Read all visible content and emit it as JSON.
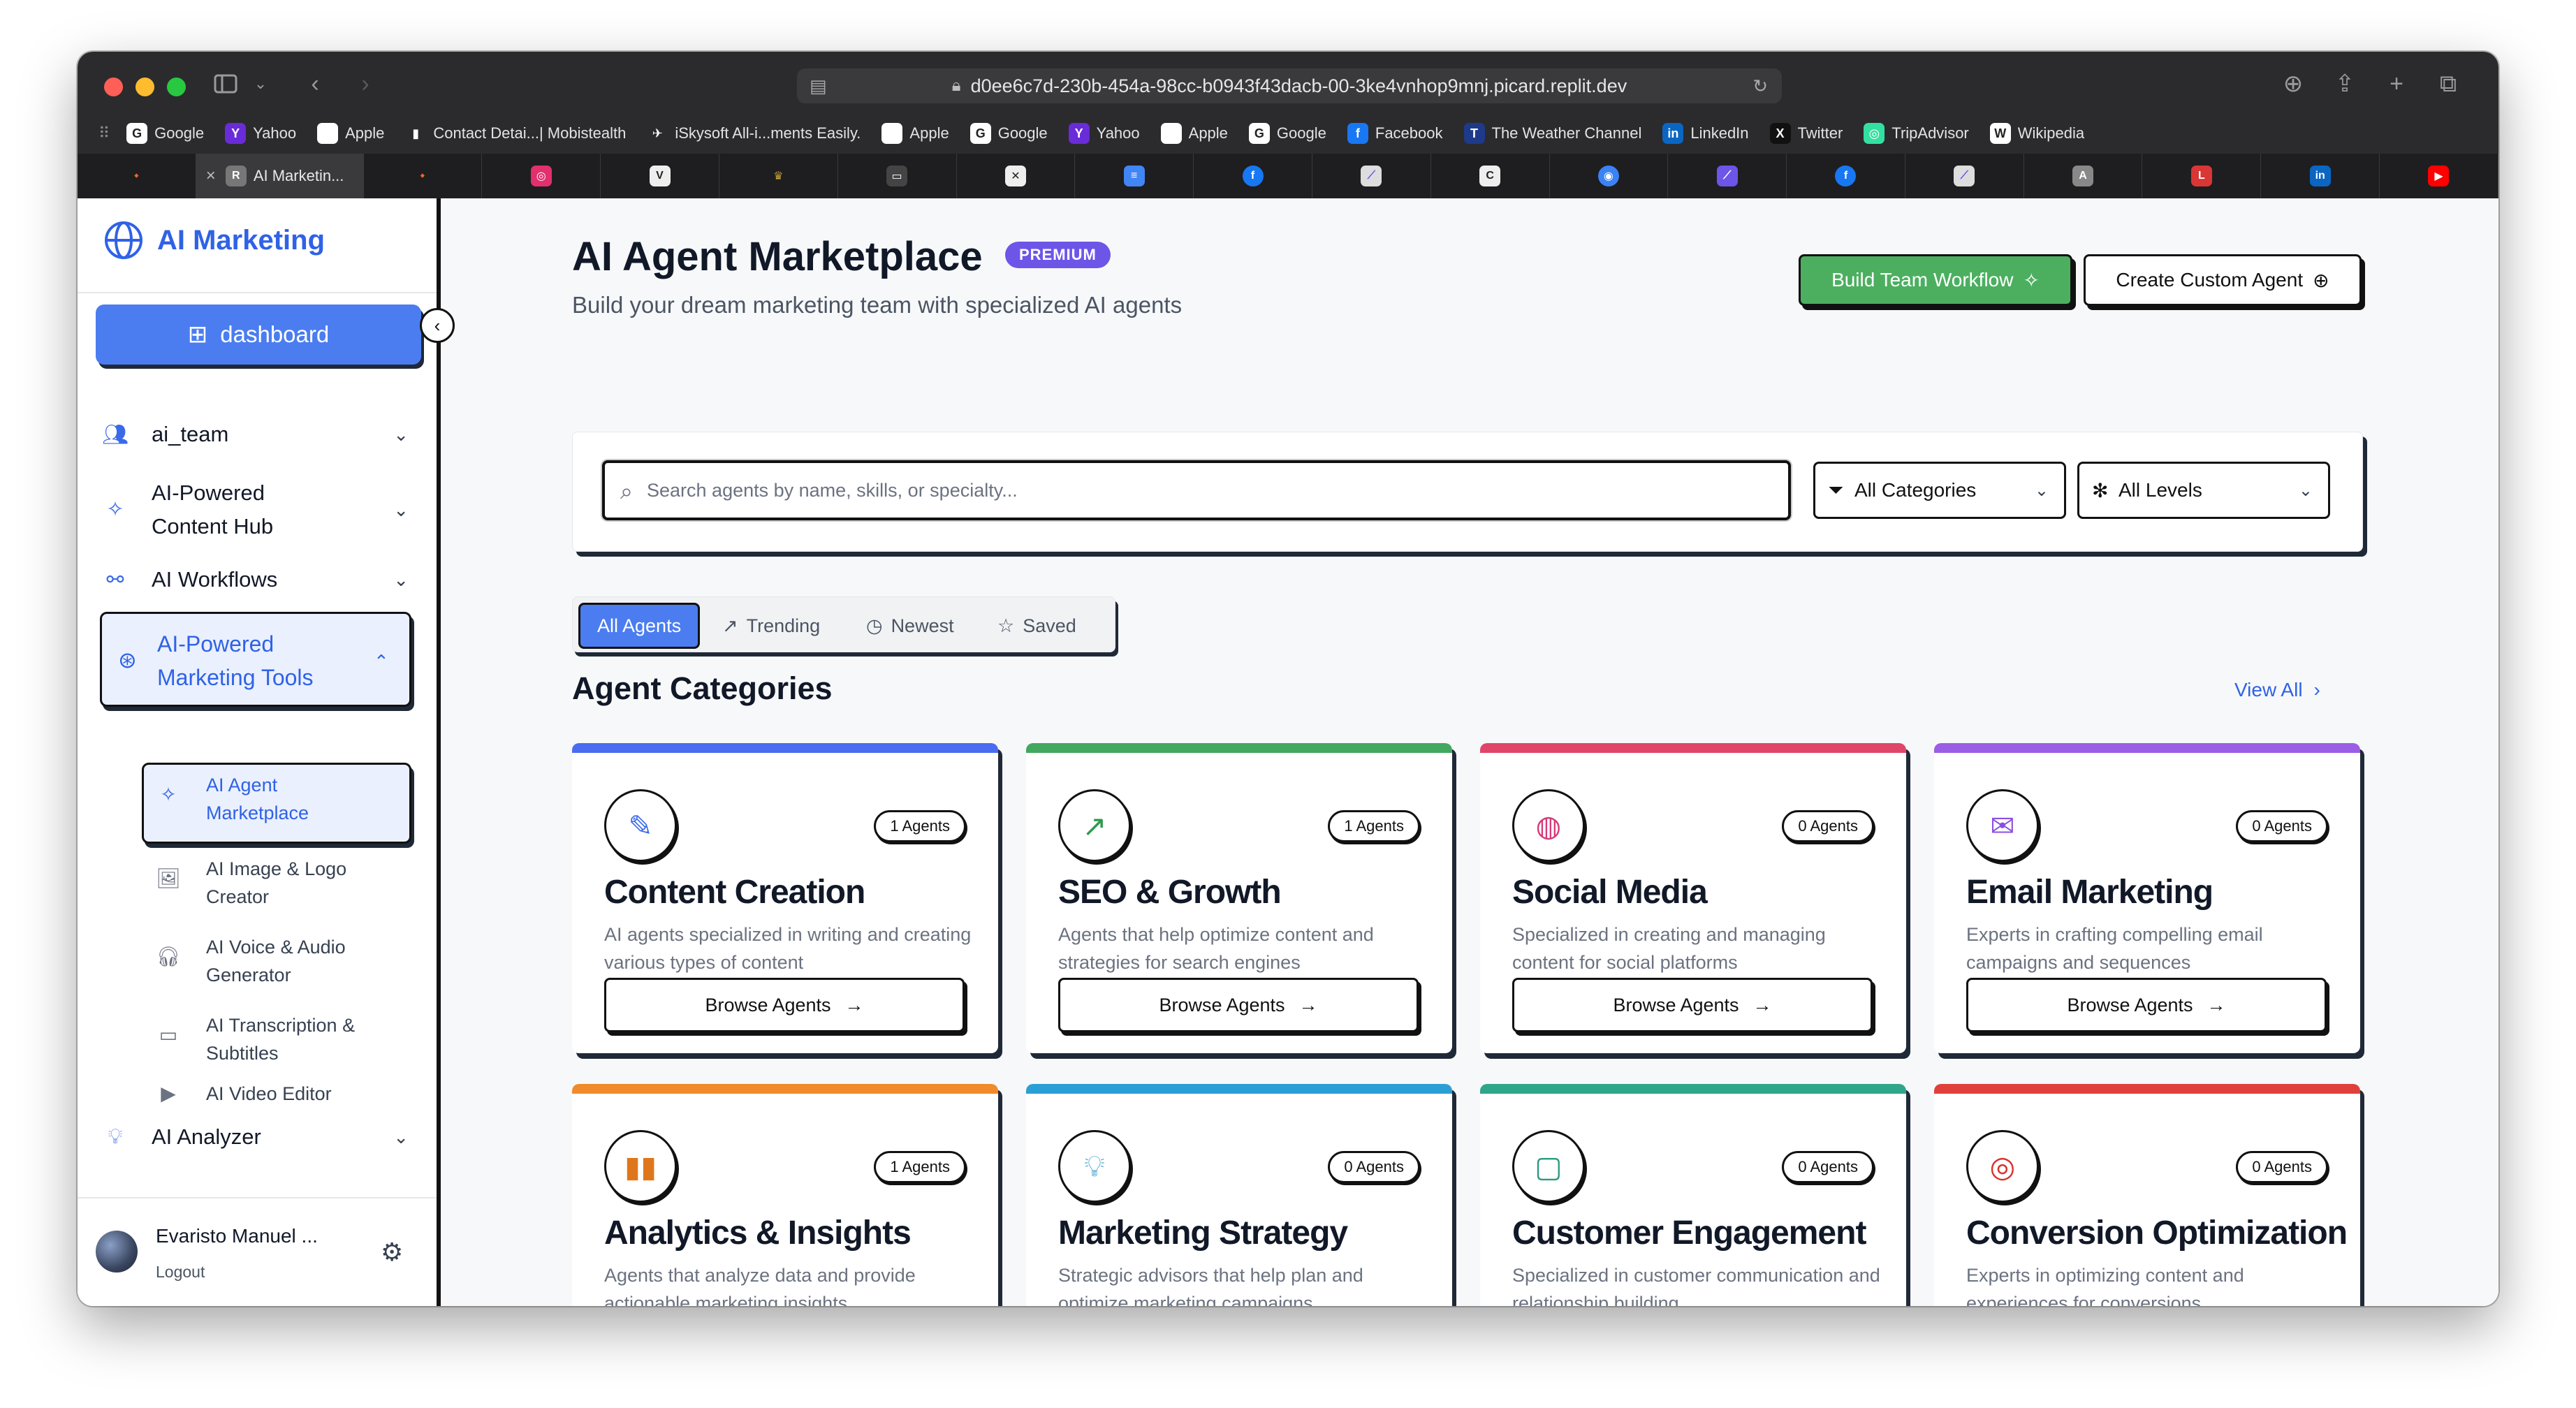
{
  "browser": {
    "url": "d0ee6c7d-230b-454a-98cc-b0943f43dacb-00-3ke4vnhop9mnj.picard.replit.dev",
    "bookmarks": [
      {
        "label": "Google",
        "color": "#ffffff",
        "glyph": "G"
      },
      {
        "label": "Yahoo",
        "color": "#6a2bd8",
        "glyph": "Y"
      },
      {
        "label": "Apple",
        "color": "#ffffff",
        "glyph": ""
      },
      {
        "label": "Contact Detai...| Mobistealth",
        "color": "#2b2b2d",
        "glyph": "▮"
      },
      {
        "label": "iSkysoft All-i...ments Easily.",
        "color": "#2b2b2d",
        "glyph": "✈"
      },
      {
        "label": "Apple",
        "color": "#ffffff",
        "glyph": ""
      },
      {
        "label": "Google",
        "color": "#ffffff",
        "glyph": "G"
      },
      {
        "label": "Yahoo",
        "color": "#6a2bd8",
        "glyph": "Y"
      },
      {
        "label": "Apple",
        "color": "#ffffff",
        "glyph": ""
      },
      {
        "label": "Google",
        "color": "#ffffff",
        "glyph": "G"
      },
      {
        "label": "Facebook",
        "color": "#1877f2",
        "glyph": "f"
      },
      {
        "label": "The Weather Channel",
        "color": "#1e3a8a",
        "glyph": "T"
      },
      {
        "label": "LinkedIn",
        "color": "#0a66c2",
        "glyph": "in"
      },
      {
        "label": "Twitter",
        "color": "#111111",
        "glyph": "X"
      },
      {
        "label": "TripAdvisor",
        "color": "#34e0a1",
        "glyph": "◎"
      },
      {
        "label": "Wikipedia",
        "color": "#ffffff",
        "glyph": "W"
      }
    ],
    "active_tab": "AI Marketin..."
  },
  "sidebar": {
    "brand": "AI Marketing",
    "dashboard_label": "dashboard",
    "nav": [
      {
        "label": "ai_team",
        "icon": "users-icon"
      },
      {
        "label": "AI-Powered Content Hub",
        "icon": "sparkle-icon"
      },
      {
        "label": "AI Workflows",
        "icon": "workflow-icon"
      }
    ],
    "active_group": "AI-Powered Marketing Tools",
    "sub_items": [
      {
        "label": "AI Agent Marketplace",
        "icon": "sparkle-icon",
        "active": true
      },
      {
        "label": "AI Image & Logo Creator",
        "icon": "image-icon"
      },
      {
        "label": "AI Voice & Audio Generator",
        "icon": "headphones-icon"
      },
      {
        "label": "AI Transcription & Subtitles",
        "icon": "subtitles-icon"
      },
      {
        "label": "AI Video Editor",
        "icon": "video-icon"
      }
    ],
    "analyzer_label": "AI Analyzer",
    "user_name": "Evaristo Manuel ...",
    "logout_label": "Logout"
  },
  "main": {
    "title": "AI Agent Marketplace",
    "badge": "PREMIUM",
    "subtitle": "Build your dream marketing team with specialized AI agents",
    "build_button": "Build Team Workflow",
    "create_button": "Create Custom Agent",
    "search_placeholder": "Search agents by name, skills, or specialty...",
    "category_select": "All Categories",
    "level_select": "All Levels",
    "tabs": [
      "All Agents",
      "Trending",
      "Newest",
      "Saved"
    ],
    "section_title": "Agent Categories",
    "view_all": "View All",
    "browse_label": "Browse Agents"
  },
  "categories": [
    {
      "title": "Content Creation",
      "count": "1 Agents",
      "desc": "AI agents specialized in writing and creating various types of content",
      "icon": "pen-icon",
      "color": "#4a6cf0",
      "icon_color": "#3b6ae8"
    },
    {
      "title": "SEO & Growth",
      "count": "1 Agents",
      "desc": "Agents that help optimize content and strategies for search engines",
      "icon": "trending-up-icon",
      "color": "#42a85f",
      "icon_color": "#2f9a4f"
    },
    {
      "title": "Social Media",
      "count": "0 Agents",
      "desc": "Specialized in creating and managing content for social platforms",
      "icon": "globe-icon",
      "color": "#e0456a",
      "icon_color": "#d63a7a"
    },
    {
      "title": "Email Marketing",
      "count": "0 Agents",
      "desc": "Experts in crafting compelling email campaigns and sequences",
      "icon": "mail-icon",
      "color": "#9b5de5",
      "icon_color": "#8b4fe0"
    },
    {
      "title": "Analytics & Insights",
      "count": "1 Agents",
      "desc": "Agents that analyze data and provide actionable marketing insights",
      "icon": "bar-chart-icon",
      "color": "#f08a2a",
      "icon_color": "#e0761c"
    },
    {
      "title": "Marketing Strategy",
      "count": "0 Agents",
      "desc": "Strategic advisors that help plan and optimize marketing campaigns",
      "icon": "lightbulb-icon",
      "color": "#2a9fd6",
      "icon_color": "#1f8fc6"
    },
    {
      "title": "Customer Engagement",
      "count": "0 Agents",
      "desc": "Specialized in customer communication and relationship building",
      "icon": "chat-icon",
      "color": "#2fa58a",
      "icon_color": "#2a9a7e"
    },
    {
      "title": "Conversion Optimization",
      "count": "0 Agents",
      "desc": "Experts in optimizing content and experiences for conversions",
      "icon": "target-icon",
      "color": "#e0403c",
      "icon_color": "#d9322e"
    }
  ]
}
